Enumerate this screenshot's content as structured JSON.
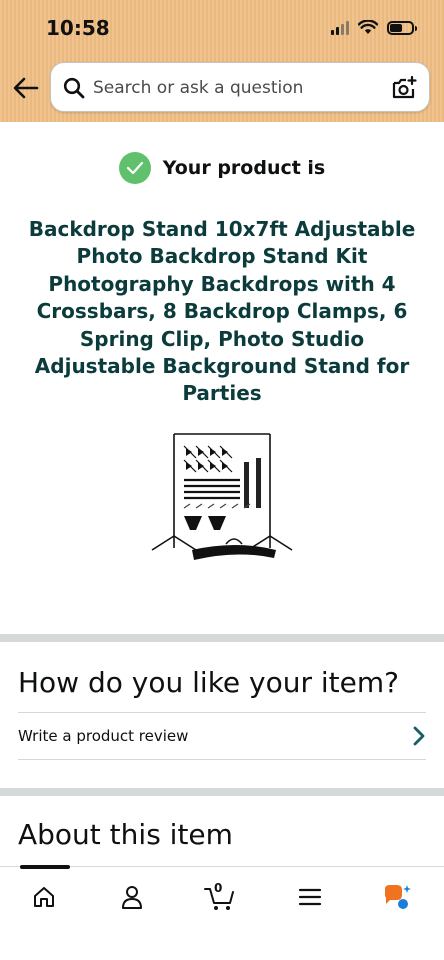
{
  "status_bar": {
    "time": "10:58"
  },
  "search": {
    "placeholder": "Search or ask a question"
  },
  "confirmation": {
    "text": "Your product is"
  },
  "product": {
    "title": "Backdrop Stand 10x7ft Adjustable Photo Backdrop Stand Kit Photography Backdrops with 4 Crossbars, 8 Backdrop Clamps, 6 Spring Clip, Photo Studio Adjustable Background Stand for Parties"
  },
  "review_section": {
    "heading": "How do you like your item?",
    "link_label": "Write a product review"
  },
  "about_section": {
    "heading": "About this item"
  },
  "bottom_nav": {
    "cart_count": "0",
    "items": [
      "home-icon",
      "account-icon",
      "cart-icon",
      "menu-icon",
      "ai-assistant-icon"
    ]
  },
  "colors": {
    "header_bg": "#f1c48f",
    "check_green": "#5fc16b",
    "title_teal": "#0b3b3b",
    "chevron_teal": "#1a5b6b",
    "assistant_orange": "#f0731f",
    "assistant_blue": "#1c7ed6"
  }
}
